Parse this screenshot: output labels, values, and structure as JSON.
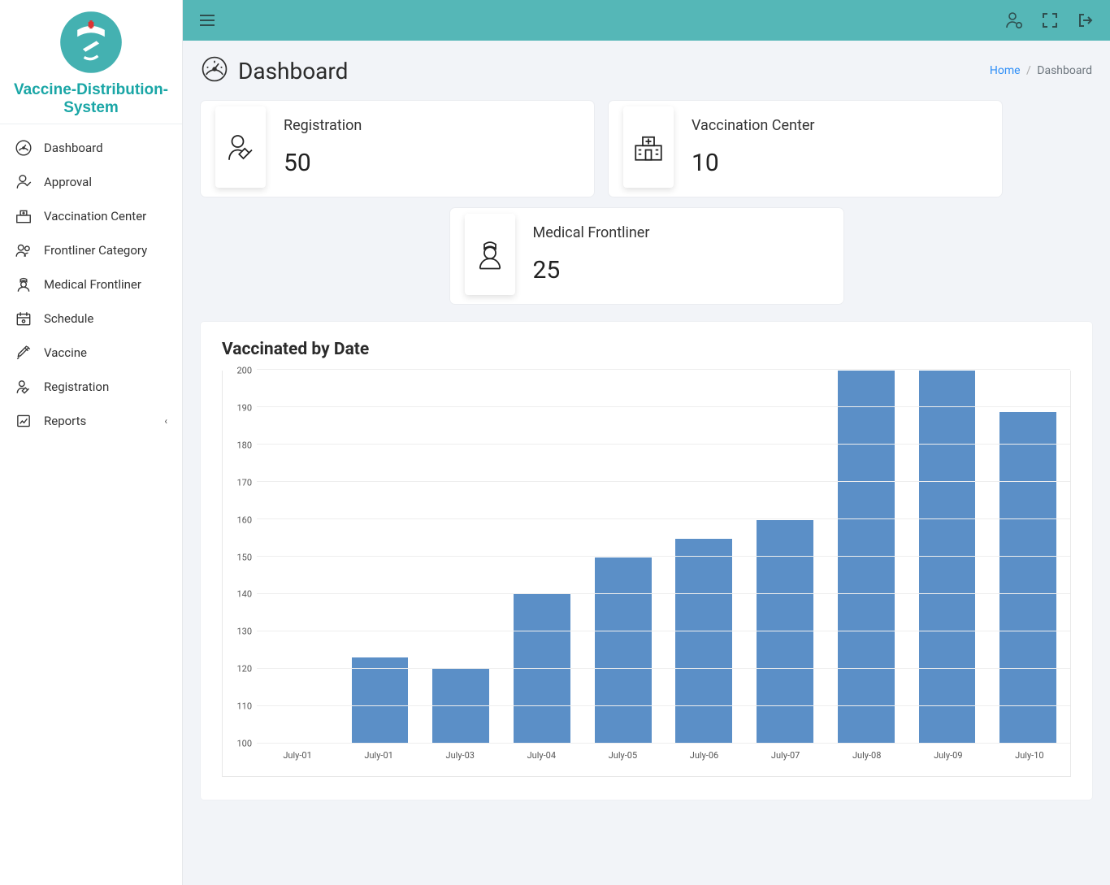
{
  "brand": {
    "title": "Vaccine-Distribution-System"
  },
  "sidebar": {
    "items": [
      {
        "label": "Dashboard",
        "icon": "gauge-icon"
      },
      {
        "label": "Approval",
        "icon": "approval-icon"
      },
      {
        "label": "Vaccination Center",
        "icon": "hospital-icon"
      },
      {
        "label": "Frontliner Category",
        "icon": "people-icon"
      },
      {
        "label": "Medical Frontliner",
        "icon": "nurse-icon"
      },
      {
        "label": "Schedule",
        "icon": "calendar-icon"
      },
      {
        "label": "Vaccine",
        "icon": "syringe-icon"
      },
      {
        "label": "Registration",
        "icon": "register-icon"
      },
      {
        "label": "Reports",
        "icon": "report-icon",
        "has_submenu": true
      }
    ]
  },
  "header": {
    "page_title": "Dashboard",
    "breadcrumb": {
      "home": "Home",
      "current": "Dashboard"
    }
  },
  "cards": [
    {
      "label": "Registration",
      "value": "50",
      "icon": "register-big-icon"
    },
    {
      "label": "Vaccination Center",
      "value": "10",
      "icon": "hospital-big-icon"
    },
    {
      "label": "Medical Frontliner",
      "value": "25",
      "icon": "nurse-big-icon"
    }
  ],
  "chart": {
    "title": "Vaccinated by Date"
  },
  "colors": {
    "accent": "#55b7b7",
    "bar": "#5b8fc7",
    "link": "#2d8ef7"
  },
  "chart_data": {
    "type": "bar",
    "title": "Vaccinated by Date",
    "categories": [
      "July-01",
      "July-01",
      "July-03",
      "July-04",
      "July-05",
      "July-06",
      "July-07",
      "July-08",
      "July-09",
      "July-10"
    ],
    "values": [
      123,
      120,
      140,
      150,
      155,
      160,
      200,
      200,
      189
    ],
    "xlabel": "",
    "ylabel": "",
    "ylim": [
      100,
      200
    ],
    "yticks": [
      100,
      110,
      120,
      130,
      140,
      150,
      160,
      170,
      180,
      190,
      200
    ]
  }
}
